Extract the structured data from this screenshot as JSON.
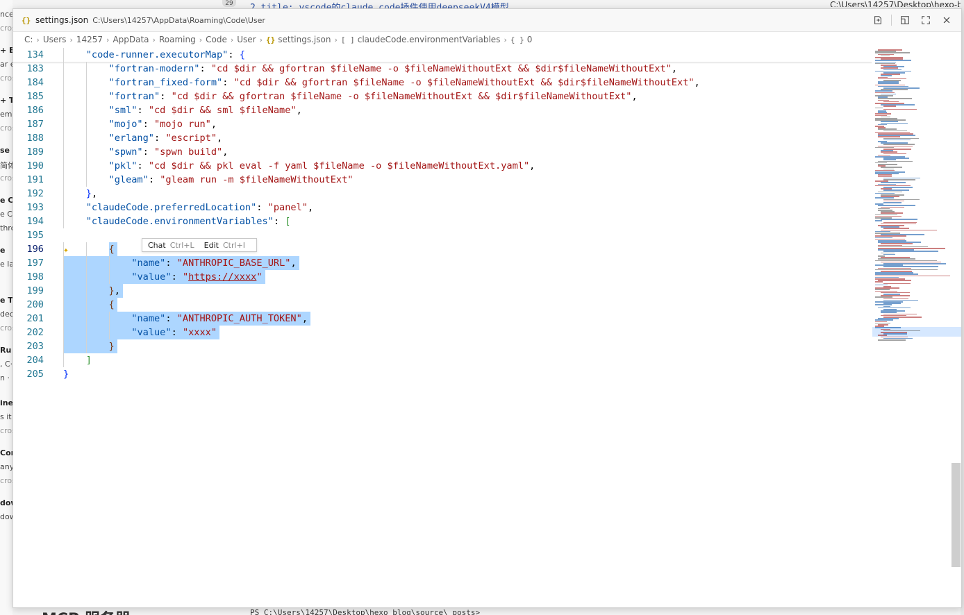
{
  "background": {
    "left_fragments": [
      {
        "text": "nceа",
        "bold": false
      },
      {
        "text": "cros",
        "bold": false
      },
      {
        "text": "+ E",
        "bold": true
      },
      {
        "text": "ar e",
        "bold": false
      },
      {
        "text": "cros",
        "bold": false
      },
      {
        "text": "+ T",
        "bold": true
      },
      {
        "text": "eme",
        "bold": false
      },
      {
        "text": "cros",
        "bold": false
      },
      {
        "text": "se",
        "bold": true
      },
      {
        "text": "简体",
        "bold": false
      },
      {
        "text": "cros",
        "bold": false
      },
      {
        "text": "e C",
        "bold": true
      },
      {
        "text": "e C",
        "bold": false
      },
      {
        "text": "thro",
        "bold": false
      },
      {
        "text": "e",
        "bold": true
      },
      {
        "text": "e la",
        "bold": false
      },
      {
        "text": "e T",
        "bold": true
      },
      {
        "text": "dec",
        "bold": false
      },
      {
        "text": "cros",
        "bold": false
      },
      {
        "text": "Ru",
        "bold": true
      },
      {
        "text": ", C·",
        "bold": false
      },
      {
        "text": "n ·",
        "bold": false
      },
      {
        "text": "ine",
        "bold": true
      },
      {
        "text": "s it",
        "bold": false
      },
      {
        "text": "cros",
        "bold": false
      },
      {
        "text": "Con",
        "bold": true
      },
      {
        "text": "any",
        "bold": false
      },
      {
        "text": "cros",
        "bold": false
      },
      {
        "text": "dow",
        "bold": true
      },
      {
        "text": "dow",
        "bold": false
      }
    ],
    "top_badge": "29",
    "top_code": "2    title: vscode的claude code插件使用deepseekV4模型",
    "top_right": "C:\\Users\\14257\\Desktop\\hexo-blo",
    "bottom_heading": "MCP 服务器",
    "bottom_terminal": "PS C:\\Users\\14257\\Desktop\\hexo_blog\\source\\_posts>"
  },
  "window": {
    "title_file": "settings.json",
    "title_path": "C:\\Users\\14257\\AppData\\Roaming\\Code\\User",
    "title_icon": "{}"
  },
  "breadcrumb": {
    "items": [
      "C:",
      "Users",
      "14257",
      "AppData",
      "Roaming",
      "Code",
      "User"
    ],
    "file": "settings.json",
    "file_icon": "{}",
    "array_icon": "[ ]",
    "array_key": "claudeCode.environmentVariables",
    "obj_icon": "{ }",
    "obj_key": "0"
  },
  "editor": {
    "lines": [
      {
        "n": "134",
        "indent": 1,
        "tokens": [
          [
            "k",
            "\"code-runner.executorMap\""
          ],
          [
            "p",
            ": "
          ],
          [
            "b1",
            "{"
          ]
        ]
      },
      {
        "n": "183",
        "indent": 2,
        "tokens": [
          [
            "k",
            "\"fortran-modern\""
          ],
          [
            "p",
            ": "
          ],
          [
            "s",
            "\"cd $dir && gfortran $fileName -o $fileNameWithoutExt && $dir$fileNameWithoutExt\""
          ],
          [
            "p",
            ","
          ]
        ]
      },
      {
        "n": "184",
        "indent": 2,
        "tokens": [
          [
            "k",
            "\"fortran_fixed-form\""
          ],
          [
            "p",
            ": "
          ],
          [
            "s",
            "\"cd $dir && gfortran $fileName -o $fileNameWithoutExt && $dir$fileNameWithoutExt\""
          ],
          [
            "p",
            ","
          ]
        ]
      },
      {
        "n": "185",
        "indent": 2,
        "tokens": [
          [
            "k",
            "\"fortran\""
          ],
          [
            "p",
            ": "
          ],
          [
            "s",
            "\"cd $dir && gfortran $fileName -o $fileNameWithoutExt && $dir$fileNameWithoutExt\""
          ],
          [
            "p",
            ","
          ]
        ]
      },
      {
        "n": "186",
        "indent": 2,
        "tokens": [
          [
            "k",
            "\"sml\""
          ],
          [
            "p",
            ": "
          ],
          [
            "s",
            "\"cd $dir && sml $fileName\""
          ],
          [
            "p",
            ","
          ]
        ]
      },
      {
        "n": "187",
        "indent": 2,
        "tokens": [
          [
            "k",
            "\"mojo\""
          ],
          [
            "p",
            ": "
          ],
          [
            "s",
            "\"mojo run\""
          ],
          [
            "p",
            ","
          ]
        ]
      },
      {
        "n": "188",
        "indent": 2,
        "tokens": [
          [
            "k",
            "\"erlang\""
          ],
          [
            "p",
            ": "
          ],
          [
            "s",
            "\"escript\""
          ],
          [
            "p",
            ","
          ]
        ]
      },
      {
        "n": "189",
        "indent": 2,
        "tokens": [
          [
            "k",
            "\"spwn\""
          ],
          [
            "p",
            ": "
          ],
          [
            "s",
            "\"spwn build\""
          ],
          [
            "p",
            ","
          ]
        ]
      },
      {
        "n": "190",
        "indent": 2,
        "tokens": [
          [
            "k",
            "\"pkl\""
          ],
          [
            "p",
            ": "
          ],
          [
            "s",
            "\"cd $dir && pkl eval -f yaml $fileName -o $fileNameWithoutExt.yaml\""
          ],
          [
            "p",
            ","
          ]
        ]
      },
      {
        "n": "191",
        "indent": 2,
        "tokens": [
          [
            "k",
            "\"gleam\""
          ],
          [
            "p",
            ": "
          ],
          [
            "s",
            "\"gleam run -m $fileNameWithoutExt\""
          ]
        ]
      },
      {
        "n": "192",
        "indent": 1,
        "tokens": [
          [
            "b1",
            "}"
          ],
          [
            "p",
            ","
          ]
        ]
      },
      {
        "n": "193",
        "indent": 1,
        "tokens": [
          [
            "k",
            "\"claudeCode.preferredLocation\""
          ],
          [
            "p",
            ": "
          ],
          [
            "s",
            "\"panel\""
          ],
          [
            "p",
            ","
          ]
        ]
      },
      {
        "n": "194",
        "indent": 1,
        "tokens": [
          [
            "k",
            "\"claudeCode.environmentVariables\""
          ],
          [
            "p",
            ": "
          ],
          [
            "b2",
            "["
          ]
        ]
      },
      {
        "n": "195",
        "indent": 0,
        "tokens": []
      },
      {
        "n": "196",
        "indent": 2,
        "tokens": [
          [
            "b3",
            "{"
          ]
        ],
        "active": true
      },
      {
        "n": "197",
        "indent": 3,
        "tokens": [
          [
            "k",
            "\"name\""
          ],
          [
            "p",
            ": "
          ],
          [
            "s",
            "\"ANTHROPIC_BASE_URL\""
          ],
          [
            "p",
            ","
          ]
        ]
      },
      {
        "n": "198",
        "indent": 3,
        "tokens": [
          [
            "k",
            "\"value\""
          ],
          [
            "p",
            ": "
          ],
          [
            "s",
            "\""
          ],
          [
            "slnk",
            "https://xxxx"
          ],
          [
            "s",
            "\""
          ]
        ]
      },
      {
        "n": "199",
        "indent": 2,
        "tokens": [
          [
            "b3",
            "}"
          ],
          [
            "p",
            ","
          ]
        ]
      },
      {
        "n": "200",
        "indent": 2,
        "tokens": [
          [
            "b3",
            "{"
          ]
        ]
      },
      {
        "n": "201",
        "indent": 3,
        "tokens": [
          [
            "k",
            "\"name\""
          ],
          [
            "p",
            ": "
          ],
          [
            "s",
            "\"ANTHROPIC_AUTH_TOKEN\""
          ],
          [
            "p",
            ","
          ]
        ]
      },
      {
        "n": "202",
        "indent": 3,
        "tokens": [
          [
            "k",
            "\"value\""
          ],
          [
            "p",
            ": "
          ],
          [
            "s",
            "\"xxxx\""
          ]
        ]
      },
      {
        "n": "203",
        "indent": 2,
        "tokens": [
          [
            "b3",
            "}"
          ]
        ]
      },
      {
        "n": "204",
        "indent": 1,
        "tokens": [
          [
            "b2",
            "]"
          ]
        ]
      },
      {
        "n": "205",
        "indent": 0,
        "tokens": [
          [
            "b1",
            "}"
          ]
        ]
      }
    ],
    "hint": {
      "chat_label": "Chat",
      "chat_key": "Ctrl+L",
      "edit_label": "Edit",
      "edit_key": "Ctrl+I"
    },
    "sparkle_icon": "✦"
  },
  "colors": {
    "key": "#0451a5",
    "string": "#a31515",
    "selection": "#add6ff",
    "line_number": "#237893"
  }
}
